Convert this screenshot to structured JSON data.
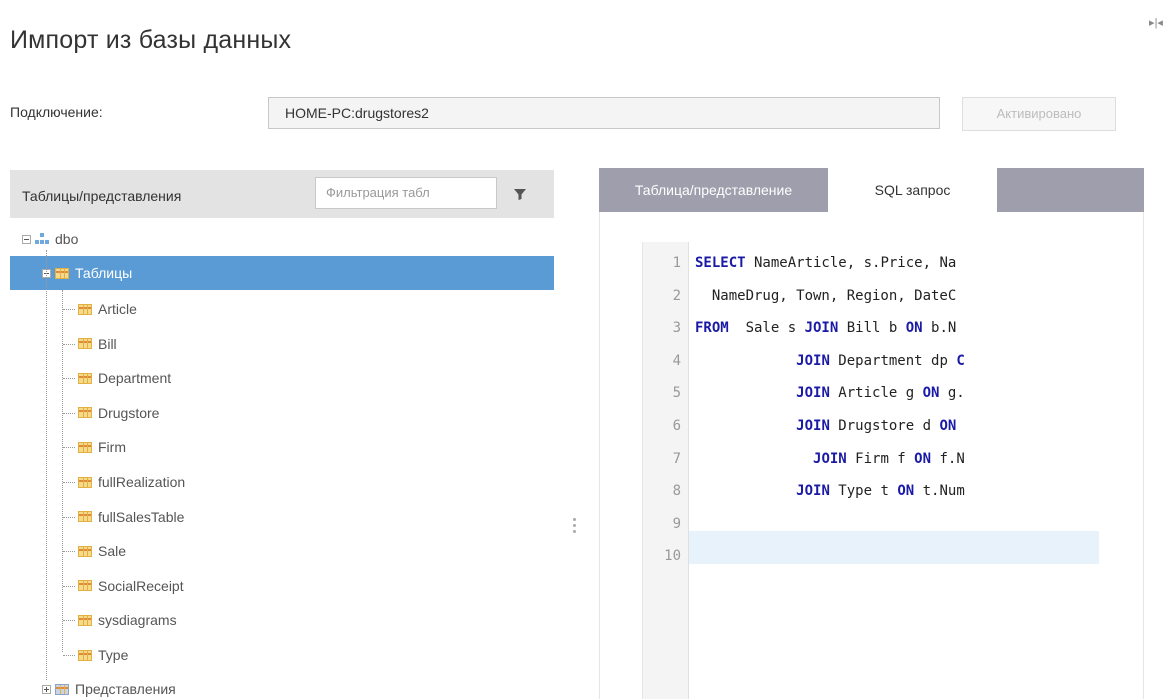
{
  "title": "Импорт из базы данных",
  "connection": {
    "label": "Подключение:",
    "value": "HOME-PC:drugstores2",
    "button": "Активировано"
  },
  "left_panel": {
    "header": "Таблицы/представления",
    "filter_placeholder": "Фильтрация табл",
    "schema": "dbo",
    "tables_node": "Таблицы",
    "tables": [
      "Article",
      "Bill",
      "Department",
      "Drugstore",
      "Firm",
      "fullRealization",
      "fullSalesTable",
      "Sale",
      "SocialReceipt",
      "sysdiagrams",
      "Type"
    ],
    "views_node": "Представления"
  },
  "right_panel": {
    "tabs": [
      "Таблица/представление",
      "SQL запрос"
    ],
    "active_tab": "SQL запрос",
    "line_numbers": [
      "1",
      "2",
      "3",
      "4",
      "5",
      "6",
      "7",
      "8",
      "9",
      "10"
    ],
    "code_lines": [
      [
        {
          "t": "SELECT",
          "k": true
        },
        {
          "t": " NameArticle, s.Price, Na",
          "k": false
        }
      ],
      [
        {
          "t": "  NameDrug, Town, Region, DateC",
          "k": false
        }
      ],
      [
        {
          "t": "FROM",
          "k": true
        },
        {
          "t": "  Sale s ",
          "k": false
        },
        {
          "t": "JOIN",
          "k": true
        },
        {
          "t": " Bill b ",
          "k": false
        },
        {
          "t": "ON",
          "k": true
        },
        {
          "t": " b.N",
          "k": false
        }
      ],
      [
        {
          "t": "            ",
          "k": false
        },
        {
          "t": "JOIN",
          "k": true
        },
        {
          "t": " Department dp ",
          "k": false
        },
        {
          "t": "C",
          "k": true
        }
      ],
      [
        {
          "t": "            ",
          "k": false
        },
        {
          "t": "JOIN",
          "k": true
        },
        {
          "t": " Article g ",
          "k": false
        },
        {
          "t": "ON",
          "k": true
        },
        {
          "t": " g.",
          "k": false
        }
      ],
      [
        {
          "t": "            ",
          "k": false
        },
        {
          "t": "JOIN",
          "k": true
        },
        {
          "t": " Drugstore d ",
          "k": false
        },
        {
          "t": "ON",
          "k": true
        }
      ],
      [
        {
          "t": "              ",
          "k": false
        },
        {
          "t": "JOIN",
          "k": true
        },
        {
          "t": " Firm f ",
          "k": false
        },
        {
          "t": "ON",
          "k": true
        },
        {
          "t": " f.N",
          "k": false
        }
      ],
      [
        {
          "t": "            ",
          "k": false
        },
        {
          "t": "JOIN",
          "k": true
        },
        {
          "t": " Type t ",
          "k": false
        },
        {
          "t": "ON",
          "k": true
        },
        {
          "t": " t.Num",
          "k": false
        }
      ],
      [],
      []
    ]
  },
  "colors": {
    "selection": "#5b9bd5",
    "tab_inactive": "#9e9eac",
    "keyword": "#1a1aa6"
  }
}
